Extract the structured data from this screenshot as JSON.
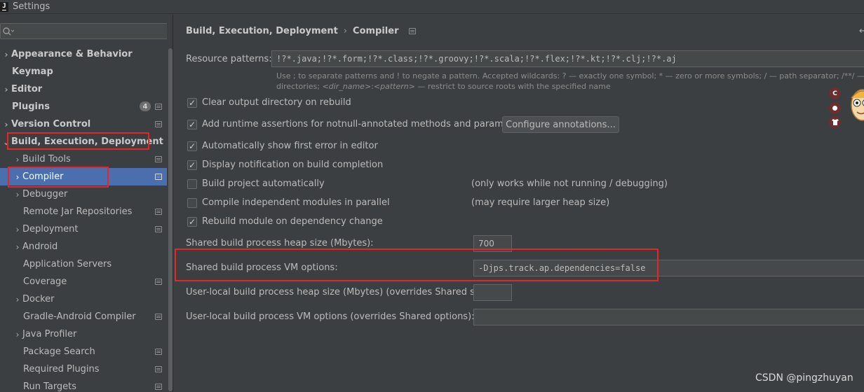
{
  "window": {
    "title": "Settings"
  },
  "sidebar": {
    "search_placeholder": "",
    "items": [
      {
        "label": "Appearance & Behavior"
      },
      {
        "label": "Keymap"
      },
      {
        "label": "Editor"
      },
      {
        "label": "Plugins",
        "badge": "4"
      },
      {
        "label": "Version Control"
      },
      {
        "label": "Build, Execution, Deployment"
      },
      {
        "label": "Build Tools"
      },
      {
        "label": "Compiler"
      },
      {
        "label": "Debugger"
      },
      {
        "label": "Remote Jar Repositories"
      },
      {
        "label": "Deployment"
      },
      {
        "label": "Android"
      },
      {
        "label": "Application Servers"
      },
      {
        "label": "Coverage"
      },
      {
        "label": "Docker"
      },
      {
        "label": "Gradle-Android Compiler"
      },
      {
        "label": "Java Profiler"
      },
      {
        "label": "Package Search"
      },
      {
        "label": "Required Plugins"
      },
      {
        "label": "Run Targets"
      }
    ]
  },
  "breadcrumb": {
    "parent": "Build, Execution, Deployment",
    "current": "Compiler"
  },
  "resource_patterns": {
    "label": "Resource patterns:",
    "value": "!?*.java;!?*.form;!?*.class;!?*.groovy;!?*.scala;!?*.flex;!?*.kt;!?*.clj;!?*.aj",
    "hint_line1": "Use ; to separate patterns and ! to negate a pattern. Accepted wildcards: ? — exactly one symbol; * — zero or more symbols; / — path separator; /**/ — any number of directories;",
    "hint_line2_a": "directories; ",
    "hint_line2_dir": "<dir_name>",
    "hint_line2_b": ":",
    "hint_line2_pat": "<pattern>",
    "hint_line2_c": " — restrict to source roots with the specified name"
  },
  "options": {
    "clear_output": {
      "label": "Clear output directory on rebuild",
      "checked": true
    },
    "runtime_assertions": {
      "label": "Add runtime assertions for notnull-annotated methods and parameters",
      "checked": true
    },
    "configure_annotations": "Configure annotations...",
    "show_first_error": {
      "label": "Automatically show first error in editor",
      "checked": true
    },
    "notify_completion": {
      "label": "Display notification on build completion",
      "checked": true
    },
    "build_auto": {
      "label": "Build project automatically",
      "checked": false,
      "note": "(only works while not running / debugging)"
    },
    "compile_parallel": {
      "label": "Compile independent modules in parallel",
      "checked": false,
      "note": "(may require larger heap size)"
    },
    "rebuild_dependency": {
      "label": "Rebuild module on dependency change",
      "checked": true
    }
  },
  "heap": {
    "label": "Shared build process heap size (Mbytes):",
    "value": "700"
  },
  "vm_options": {
    "label": "Shared build process VM options:",
    "value": "-Djps.track.ap.dependencies=false"
  },
  "user_heap": {
    "label": "User-local build process heap size (Mbytes) (overrides Shared size):",
    "value": ""
  },
  "user_vm": {
    "label": "User-local build process VM options (overrides Shared options):",
    "value": ""
  },
  "float_widget": {
    "c_label": "C"
  },
  "watermark": "CSDN @pingzhuyan",
  "colors": {
    "selection": "#4b6eaf",
    "highlight_red": "#e8242b",
    "background": "#3c3f41"
  }
}
